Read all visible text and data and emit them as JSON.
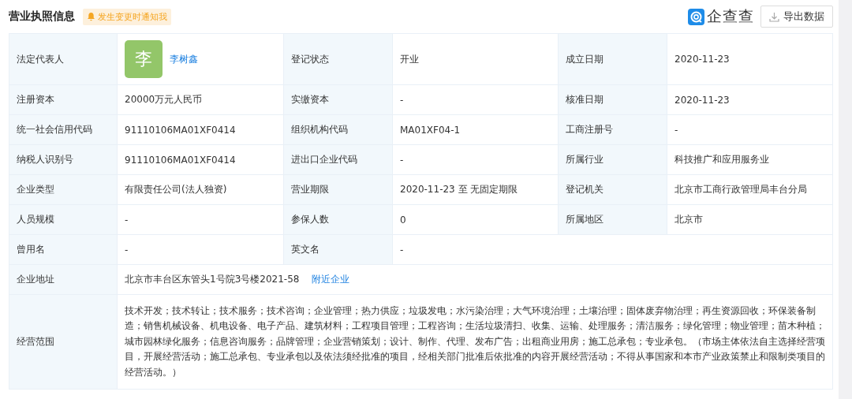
{
  "header": {
    "title": "营业执照信息",
    "notify_badge": "发生变更时通知我",
    "brand": "企查查",
    "export_button": "导出数据"
  },
  "rows": [
    {
      "cells": [
        {
          "label": "法定代表人",
          "kind": "person",
          "avatar": "李",
          "value": "李树鑫"
        },
        {
          "label": "登记状态",
          "kind": "text",
          "value": "开业"
        },
        {
          "label": "成立日期",
          "kind": "text",
          "value": "2020-11-23"
        }
      ]
    },
    {
      "cells": [
        {
          "label": "注册资本",
          "kind": "text",
          "value": "20000万元人民币"
        },
        {
          "label": "实缴资本",
          "kind": "text",
          "value": "-"
        },
        {
          "label": "核准日期",
          "kind": "text",
          "value": "2020-11-23"
        }
      ]
    },
    {
      "cells": [
        {
          "label": "统一社会信用代码",
          "kind": "text",
          "value": "91110106MA01XF0414"
        },
        {
          "label": "组织机构代码",
          "kind": "text",
          "value": "MA01XF04-1"
        },
        {
          "label": "工商注册号",
          "kind": "text",
          "value": "-"
        }
      ]
    },
    {
      "cells": [
        {
          "label": "纳税人识别号",
          "kind": "text",
          "value": "91110106MA01XF0414"
        },
        {
          "label": "进出口企业代码",
          "kind": "text",
          "value": "-"
        },
        {
          "label": "所属行业",
          "kind": "text",
          "value": "科技推广和应用服务业"
        }
      ]
    },
    {
      "cells": [
        {
          "label": "企业类型",
          "kind": "text",
          "value": "有限责任公司(法人独资)"
        },
        {
          "label": "营业期限",
          "kind": "text",
          "value": "2020-11-23 至 无固定期限"
        },
        {
          "label": "登记机关",
          "kind": "text",
          "value": "北京市工商行政管理局丰台分局"
        }
      ]
    },
    {
      "cells": [
        {
          "label": "人员规模",
          "kind": "text",
          "value": "-"
        },
        {
          "label": "参保人数",
          "kind": "text",
          "value": "0"
        },
        {
          "label": "所属地区",
          "kind": "text",
          "value": "北京市"
        }
      ]
    },
    {
      "cells": [
        {
          "label": "曾用名",
          "kind": "text",
          "value": "-"
        },
        {
          "label": "英文名",
          "kind": "text",
          "value": "-"
        }
      ]
    },
    {
      "cells": [
        {
          "label": "企业地址",
          "kind": "address",
          "value": "北京市丰台区东管头1号院3号楼2021-58",
          "link": "附近企业"
        }
      ]
    },
    {
      "cells": [
        {
          "label": "经营范围",
          "kind": "paragraph",
          "value": "技术开发；技术转让；技术服务；技术咨询；企业管理；热力供应；垃圾发电；水污染治理；大气环境治理；土壤治理；固体废弃物治理；再生资源回收；环保装备制造；销售机械设备、机电设备、电子产品、建筑材料；工程项目管理；工程咨询；生活垃圾清扫、收集、运输、处理服务；清洁服务；绿化管理；物业管理；苗木种植；城市园林绿化服务；信息咨询服务；品牌管理；企业营销策划；设计、制作、代理、发布广告；出租商业用房；施工总承包；专业承包。（市场主体依法自主选择经营项目，开展经营活动；施工总承包、专业承包以及依法须经批准的项目，经相关部门批准后依批准的内容开展经营活动；不得从事国家和本市产业政策禁止和限制类项目的经营活动。）"
        }
      ]
    }
  ]
}
